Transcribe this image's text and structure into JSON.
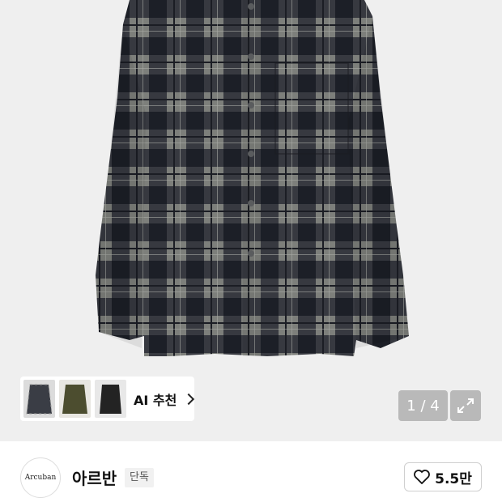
{
  "product": {
    "image_alt": "Plaid flannel shirt",
    "pager": "1 / 4",
    "expand_icon": "expand-icon"
  },
  "ai_recommend": {
    "label": "AI 추천",
    "thumbnails": [
      "plaid-shirt-thumb",
      "olive-shirt-thumb",
      "black-shirt-thumb"
    ]
  },
  "brand": {
    "logo_text": "Arcuban",
    "name": "아르반",
    "badge": "단독"
  },
  "like": {
    "icon": "heart-icon",
    "count": "5.5만"
  },
  "colors": {
    "shirt_dark": "#2c2f38",
    "shirt_gray": "#8a8b86",
    "hero_bg": "#efefef"
  }
}
